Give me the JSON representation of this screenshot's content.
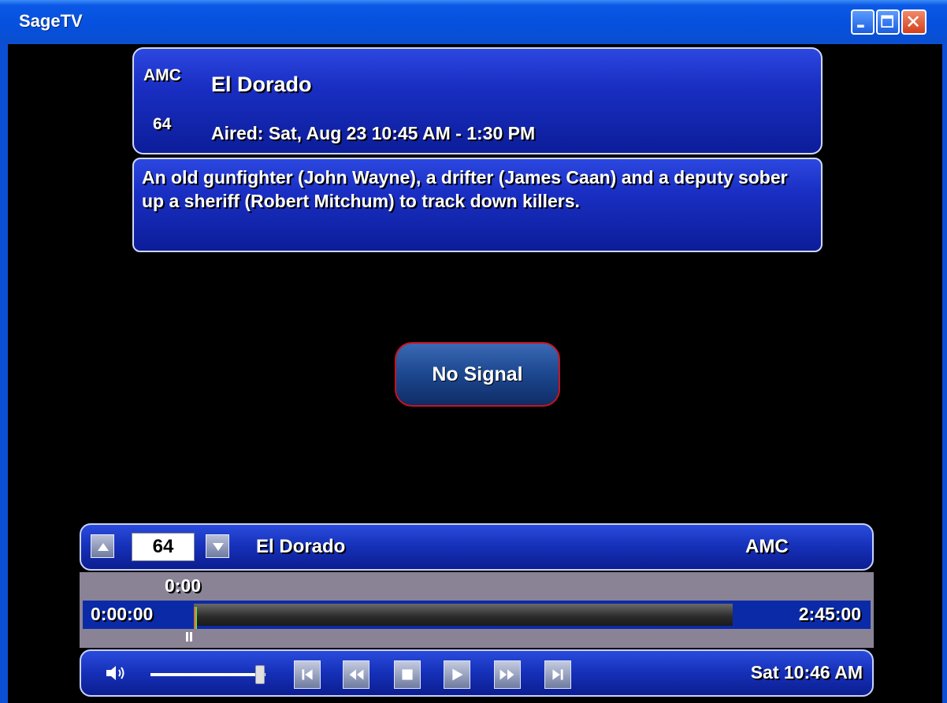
{
  "window": {
    "title": "SageTV"
  },
  "program": {
    "callsign": "AMC",
    "channel": "64",
    "title": "El Dorado",
    "aired": "Aired:  Sat, Aug 23 10:45 AM - 1:30 PM",
    "description": "An old gunfighter (John Wayne), a drifter (James Caan) and a deputy sober up a sheriff (Robert Mitchum) to track down killers."
  },
  "status": {
    "message": "No Signal"
  },
  "osd": {
    "channel": "64",
    "title": "El Dorado",
    "callsign": "AMC"
  },
  "timeline": {
    "marker": "0:00",
    "start": "0:00:00",
    "end": "2:45:00",
    "position_fraction": 0.0
  },
  "controls": {
    "volume_fraction": 0.95,
    "icons": [
      "volume-icon",
      "skip-back-icon",
      "rewind-icon",
      "stop-icon",
      "play-icon",
      "fast-forward-icon",
      "skip-forward-icon"
    ],
    "clock": "Sat  10:46 AM"
  }
}
